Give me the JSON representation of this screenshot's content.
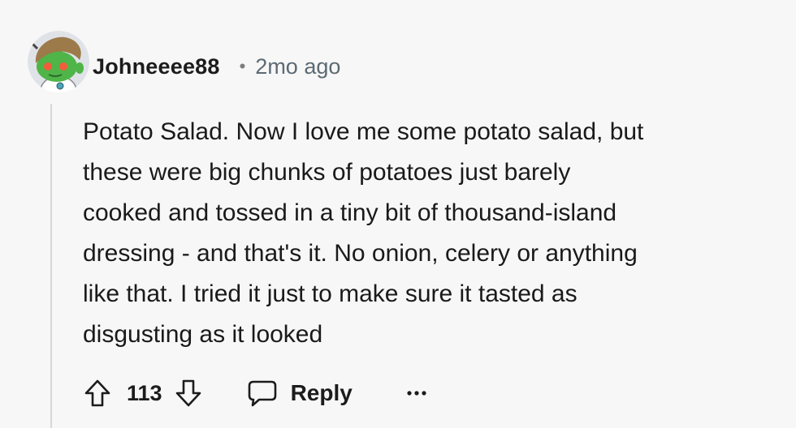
{
  "comment": {
    "author": "Johneeee88",
    "separator": "•",
    "timestamp": "2mo ago",
    "avatar_icon": "snoo-avatar-icon",
    "body_lines": [
      "Potato Salad. Now I love me some potato salad, but",
      "these were big chunks of potatoes just barely",
      "cooked and tossed in a tiny bit of thousand-island",
      "dressing - and that's it. No onion, celery or anything",
      "like that. I tried it just to make sure it tasted as",
      "disgusting as it looked"
    ],
    "actions": {
      "upvote_icon": "arrow-up-icon",
      "vote_count": "113",
      "downvote_icon": "arrow-down-icon",
      "reply_icon": "chat-bubble-icon",
      "reply_label": "Reply",
      "more_icon": "ellipsis-icon"
    }
  },
  "colors": {
    "background": "#f7f7f7",
    "text": "#1c1c1c",
    "muted": "#5c6a73",
    "thread_line": "#d5d7d9",
    "avatar_green": "#4fb548"
  }
}
